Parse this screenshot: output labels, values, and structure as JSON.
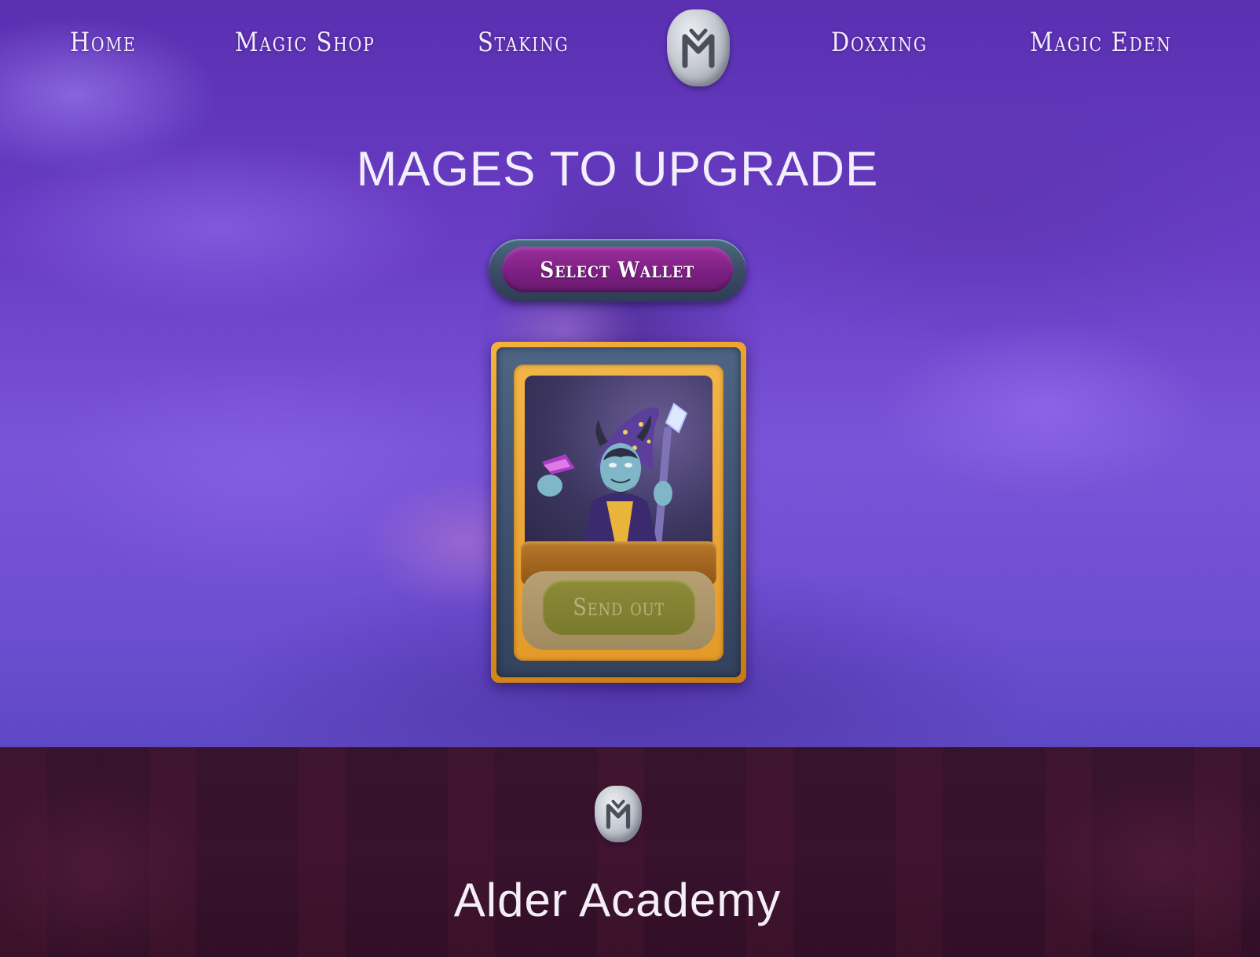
{
  "nav": {
    "home": "Home",
    "magic_shop": "Magic Shop",
    "staking": "Staking",
    "logo_icon": "rune-stone-logo",
    "doxxing": "Doxxing",
    "magic_eden": "Magic Eden"
  },
  "main": {
    "title": "MAGES TO UPGRADE",
    "select_wallet_label": "Select Wallet",
    "card": {
      "send_out_label": "Send out"
    }
  },
  "footer": {
    "logo_icon": "rune-stone-logo",
    "title": "Alder Academy"
  },
  "colors": {
    "hero_background": "#6a3fc6",
    "wallet_button": "#7d1f82",
    "card_frame": "#e0931e",
    "send_out_button": "#7a7a2e",
    "footer_background": "#3a1530"
  }
}
